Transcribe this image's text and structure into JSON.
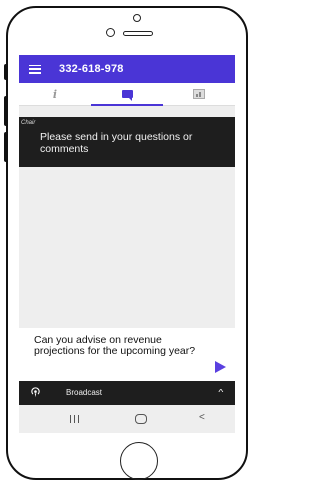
{
  "header": {
    "title": "332-618-978"
  },
  "tabs": [
    {
      "label": "i",
      "icon": "info-icon"
    },
    {
      "icon": "chat-icon"
    },
    {
      "icon": "poll-chart-icon"
    }
  ],
  "chair": {
    "label": "Chair",
    "message": "Please send in your questions or comments"
  },
  "composer": {
    "text": "Can you advise on revenue projections for the upcoming year?"
  },
  "broadcast": {
    "label": "Broadcast"
  },
  "colors": {
    "accent": "#4a35d6",
    "dark_bar": "#1e1e1e"
  }
}
